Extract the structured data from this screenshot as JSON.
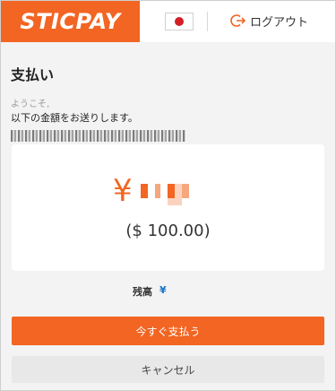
{
  "header": {
    "logo_text": "STICPAY",
    "language_flag": "japan-flag",
    "logout_label": "ログアウト",
    "brand_color": "#f26522"
  },
  "page": {
    "title": "支払い",
    "welcome": "ようこそ,",
    "instruction": "以下の金額をお送りします。"
  },
  "amount": {
    "currency_symbol": "¥",
    "usd_amount": "($ 100.00)"
  },
  "balance": {
    "label": "残高",
    "value": "¥"
  },
  "actions": {
    "pay_label": "今すぐ支払う",
    "cancel_label": "キャンセル"
  }
}
